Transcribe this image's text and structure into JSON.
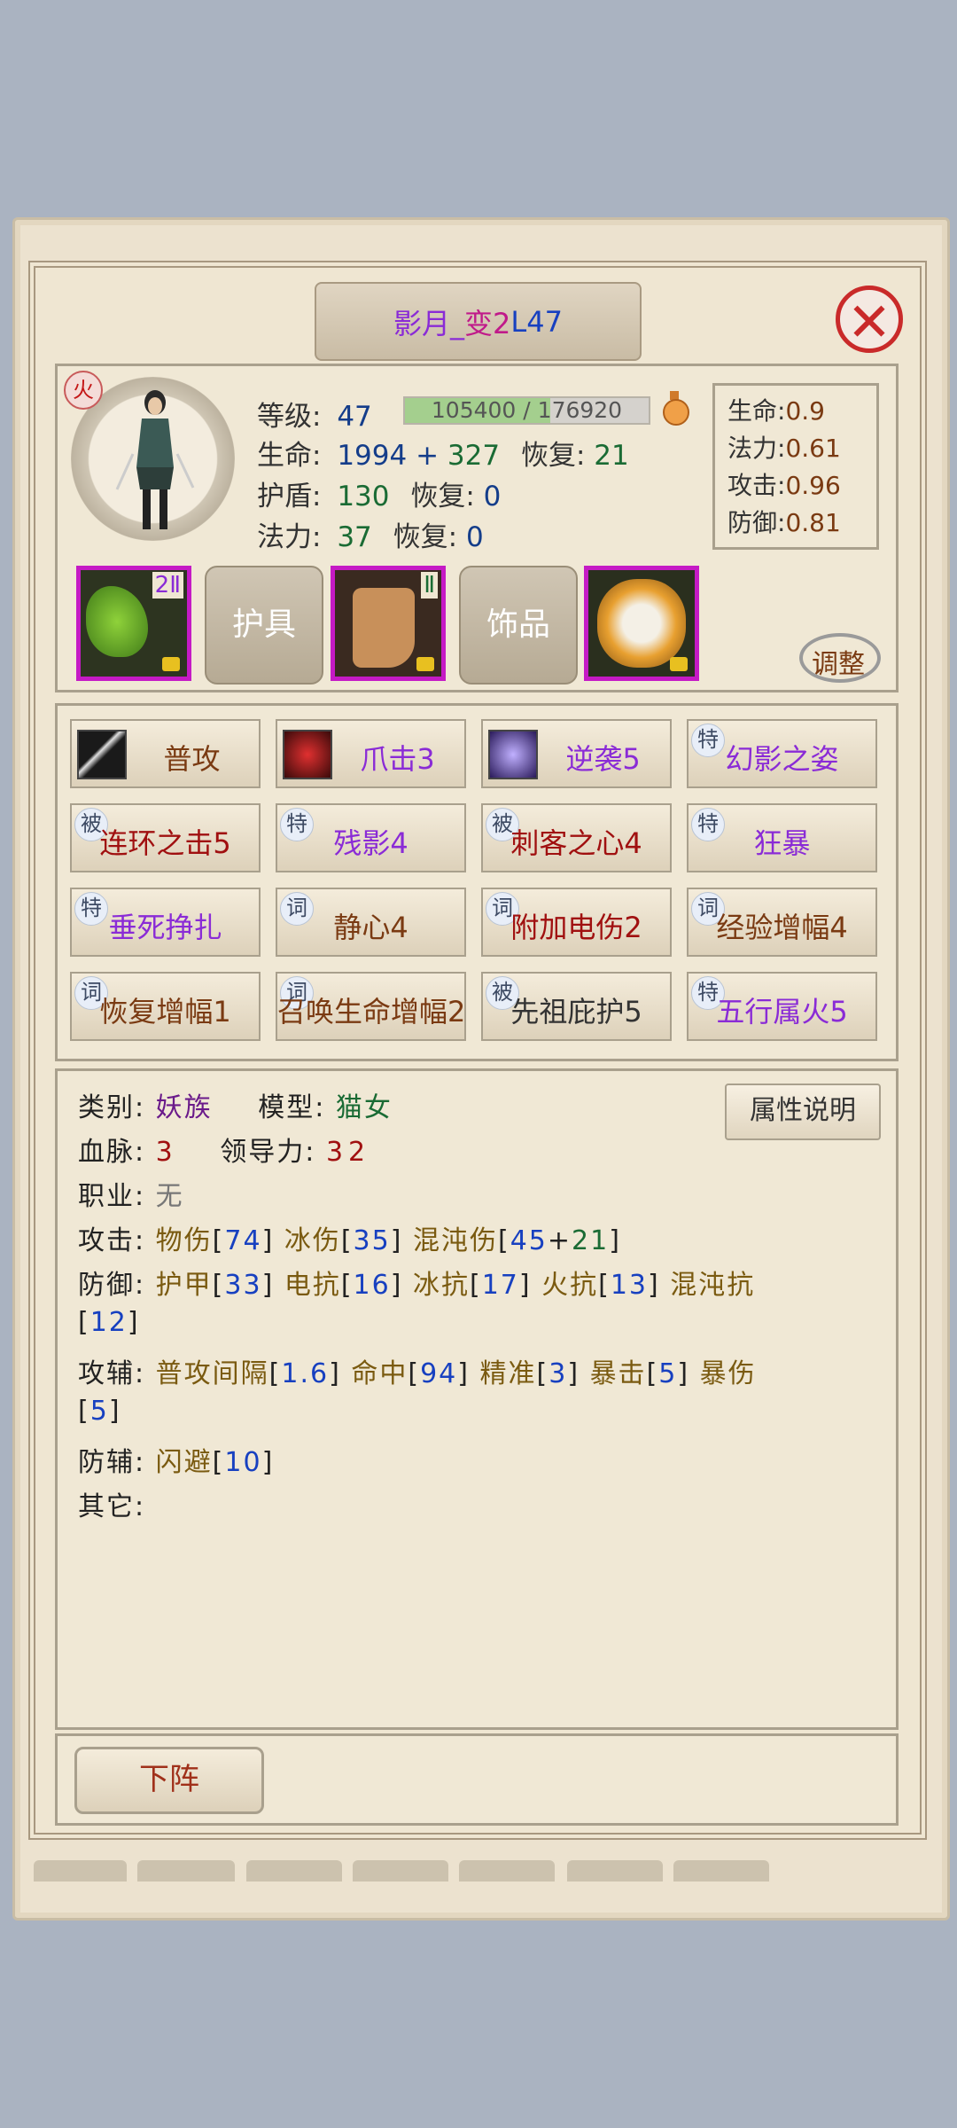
{
  "title": {
    "name": "影月_",
    "change": "变2",
    "level": "L47"
  },
  "element_badge": "火",
  "stats": {
    "level_label": "等级:",
    "level_value": "47",
    "exp_text": "105400 / 176920",
    "exp_progress": 0.596,
    "hp_label": "生命:",
    "hp_value": "1994",
    "hp_plus": "+",
    "hp_bonus": "327",
    "hp_regen_label": "恢复:",
    "hp_regen_value": "21",
    "shield_label": "护盾:",
    "shield_value": "130",
    "shield_regen_label": "恢复:",
    "shield_regen_value": "0",
    "mana_label": "法力:",
    "mana_value": "37",
    "mana_regen_label": "恢复:",
    "mana_regen_value": "0"
  },
  "growth": [
    {
      "label": "生命:",
      "value": "0.9"
    },
    {
      "label": "法力:",
      "value": "0.61"
    },
    {
      "label": "攻击:",
      "value": "0.96"
    },
    {
      "label": "防御:",
      "value": "0.81"
    }
  ],
  "equipment": {
    "slot1_tier": "2Ⅱ",
    "armor_label": "护具",
    "slot2_tier": "Ⅱ",
    "accessory_label": "饰品",
    "adjust_label": "调整"
  },
  "skills": [
    {
      "tag": "",
      "label": "普攻",
      "color": "#7a3a12",
      "icon": "sword-icon"
    },
    {
      "tag": "",
      "label": "爪击3",
      "color": "#8a2bd6",
      "icon": "claw-icon"
    },
    {
      "tag": "",
      "label": "逆袭5",
      "color": "#8a2bd6",
      "icon": "shadow-icon"
    },
    {
      "tag": "特",
      "label": "幻影之姿",
      "color": "#8a2bd6"
    },
    {
      "tag": "被",
      "label": "连环之击5",
      "color": "#a01010"
    },
    {
      "tag": "特",
      "label": "残影4",
      "color": "#8a2bd6"
    },
    {
      "tag": "被",
      "label": "刺客之心4",
      "color": "#a01010"
    },
    {
      "tag": "特",
      "label": "狂暴",
      "color": "#8a2bd6"
    },
    {
      "tag": "特",
      "label": "垂死挣扎",
      "color": "#8a2bd6"
    },
    {
      "tag": "词",
      "label": "静心4",
      "color": "#7a3a12"
    },
    {
      "tag": "词",
      "label": "附加电伤2",
      "color": "#a01010"
    },
    {
      "tag": "词",
      "label": "经验增幅4",
      "color": "#7a3a12"
    },
    {
      "tag": "词",
      "label": "恢复增幅1",
      "color": "#7a3a12"
    },
    {
      "tag": "词",
      "label": "召唤生命增幅2",
      "color": "#7a3a12"
    },
    {
      "tag": "被",
      "label": "先祖庇护5",
      "color": "#333333"
    },
    {
      "tag": "特",
      "label": "五行属火5",
      "color": "#8a2bd6"
    }
  ],
  "info": {
    "category_label": "类别:",
    "category_value": "妖族",
    "model_label": "模型:",
    "model_value": "猫女",
    "attr_button": "属性说明",
    "bloodline_label": "血脉:",
    "bloodline_value": "3",
    "leadership_label": "领导力:",
    "leadership_value": "32",
    "job_label": "职业:",
    "job_value": "无",
    "attack_label": "攻击:",
    "attack": {
      "phys": "物伤",
      "phys_v": "74",
      "ice": "冰伤",
      "ice_v": "35",
      "chaos": "混沌伤",
      "chaos_v": "45",
      "plus": "+",
      "chaos_bonus": "21"
    },
    "defense_label": "防御:",
    "defense": {
      "armor": "护甲",
      "armor_v": "33",
      "elec": "电抗",
      "elec_v": "16",
      "ice": "冰抗",
      "ice_v": "17",
      "fire": "火抗",
      "fire_v": "13",
      "chaos": "混沌抗",
      "chaos_v": "12"
    },
    "atk_aux_label": "攻辅:",
    "atk_aux": {
      "interval": "普攻间隔",
      "interval_v": "1.6",
      "hit": "命中",
      "hit_v": "94",
      "precise": "精准",
      "precise_v": "3",
      "crit": "暴击",
      "crit_v": "5",
      "critdmg": "暴伤",
      "critdmg_v": "5"
    },
    "def_aux_label": "防辅:",
    "def_aux": {
      "dodge": "闪避",
      "dodge_v": "10"
    },
    "other_label": "其它:"
  },
  "bottom_button": "下阵",
  "colors": {
    "purple": "#8a2bd6",
    "blue": "#1740c0",
    "red": "#a01010",
    "close": "#c92a2a"
  }
}
